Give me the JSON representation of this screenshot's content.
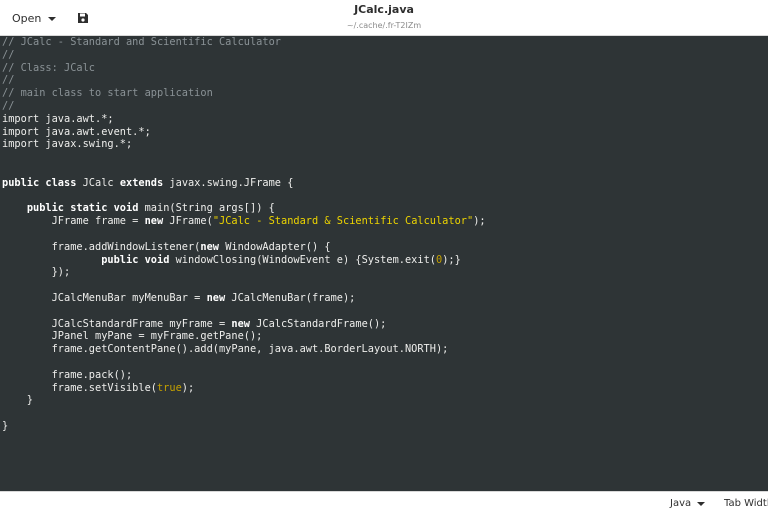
{
  "header": {
    "open_label": "Open",
    "title": "JCalc.java",
    "subtitle": "~/.cache/.fr-T2IZm",
    "save_icon": "save-document-icon",
    "dropdown_icon": "chevron-down-icon"
  },
  "editor": {
    "lines": [
      [
        [
          "comment",
          "// JCalc - Standard and Scientific Calculator"
        ]
      ],
      [
        [
          "comment",
          "//"
        ]
      ],
      [
        [
          "comment",
          "// Class: JCalc"
        ]
      ],
      [
        [
          "comment",
          "//"
        ]
      ],
      [
        [
          "comment",
          "// main class to start application"
        ]
      ],
      [
        [
          "comment",
          "//"
        ]
      ],
      [
        [
          "text",
          "import java.awt.*;"
        ]
      ],
      [
        [
          "text",
          "import java.awt.event.*;"
        ]
      ],
      [
        [
          "text",
          "import javax.swing.*;"
        ]
      ],
      [],
      [],
      [
        [
          "keyword",
          "public class"
        ],
        [
          "text",
          " JCalc "
        ],
        [
          "keyword",
          "extends"
        ],
        [
          "text",
          " javax.swing.JFrame {"
        ]
      ],
      [],
      [
        [
          "text",
          "    "
        ],
        [
          "keyword",
          "public static void"
        ],
        [
          "text",
          " main(String args[]) {"
        ]
      ],
      [
        [
          "text",
          "        JFrame frame = "
        ],
        [
          "keyword",
          "new"
        ],
        [
          "text",
          " JFrame("
        ],
        [
          "string",
          "\"JCalc - Standard & Scientific Calculator\""
        ],
        [
          "text",
          ");"
        ]
      ],
      [],
      [
        [
          "text",
          "        frame.addWindowListener("
        ],
        [
          "keyword",
          "new"
        ],
        [
          "text",
          " WindowAdapter() {"
        ]
      ],
      [
        [
          "text",
          "                "
        ],
        [
          "keyword",
          "public void"
        ],
        [
          "text",
          " windowClosing(WindowEvent e) {System.exit("
        ],
        [
          "number",
          "0"
        ],
        [
          "text",
          ");}"
        ]
      ],
      [
        [
          "text",
          "        });"
        ]
      ],
      [],
      [
        [
          "text",
          "        JCalcMenuBar myMenuBar = "
        ],
        [
          "keyword",
          "new"
        ],
        [
          "text",
          " JCalcMenuBar(frame);"
        ]
      ],
      [],
      [
        [
          "text",
          "        JCalcStandardFrame myFrame = "
        ],
        [
          "keyword",
          "new"
        ],
        [
          "text",
          " JCalcStandardFrame();"
        ]
      ],
      [
        [
          "text",
          "        JPanel myPane = myFrame.getPane();"
        ]
      ],
      [
        [
          "text",
          "        frame.getContentPane().add(myPane, java.awt.BorderLayout.NORTH);"
        ]
      ],
      [],
      [
        [
          "text",
          "        frame.pack();"
        ]
      ],
      [
        [
          "text",
          "        frame.setVisible("
        ],
        [
          "number",
          "true"
        ],
        [
          "text",
          ");"
        ]
      ],
      [
        [
          "text",
          "    }"
        ]
      ],
      [],
      [
        [
          "text",
          "}"
        ]
      ]
    ]
  },
  "status": {
    "language": "Java",
    "tab_width": "Tab Width"
  },
  "colors": {
    "editor_bg": "#2e3436",
    "comment": "#8a9296",
    "keyword": "#ffffff",
    "string": "#edd400",
    "number": "#c4a000"
  }
}
